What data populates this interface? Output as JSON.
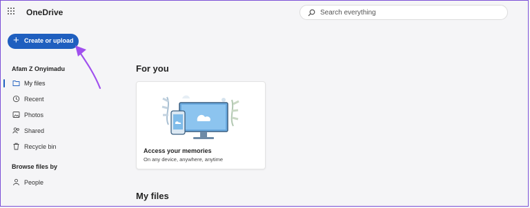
{
  "app": {
    "title": "OneDrive"
  },
  "search": {
    "placeholder": "Search everything"
  },
  "create_button": {
    "label": "Create or upload"
  },
  "sidebar": {
    "user_name": "Afam Z Onyimadu",
    "items": [
      {
        "label": "My files",
        "icon": "folder-icon",
        "active": true
      },
      {
        "label": "Recent",
        "icon": "history-icon"
      },
      {
        "label": "Photos",
        "icon": "image-icon"
      },
      {
        "label": "Shared",
        "icon": "people-icon"
      },
      {
        "label": "Recycle bin",
        "icon": "trash-icon"
      }
    ],
    "browse_heading": "Browse files by",
    "browse_items": [
      {
        "label": "People",
        "icon": "person-icon"
      }
    ]
  },
  "main": {
    "for_you_heading": "For you",
    "card": {
      "title": "Access your memories",
      "subtitle": "On any device, anywhere, anytime"
    },
    "my_files_heading": "My files"
  },
  "colors": {
    "accent": "#1f5fbf",
    "annotation_arrow": "#a050ee",
    "background": "#f5f5f7"
  }
}
